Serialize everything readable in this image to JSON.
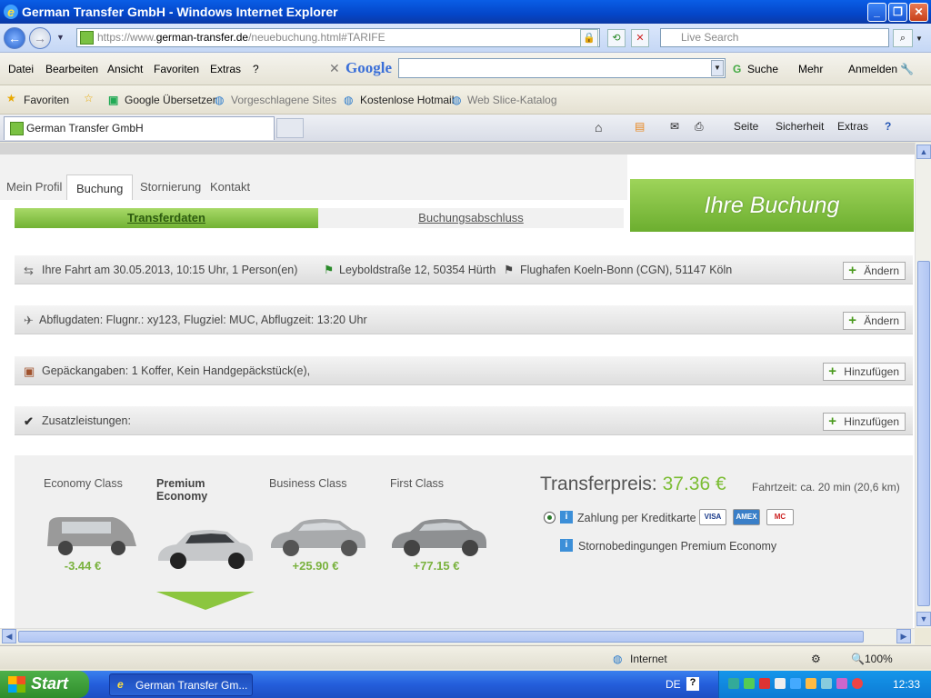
{
  "window": {
    "title": "German Transfer GmbH - Windows Internet Explorer",
    "min": "_",
    "max": "❐",
    "close": "✕"
  },
  "address": {
    "prefix": "https://www.",
    "host": "german-transfer.de",
    "path": "/neuebuchung.html#TARIFE",
    "live_search": "Live Search"
  },
  "menu": [
    "Datei",
    "Bearbeiten",
    "Ansicht",
    "Favoriten",
    "Extras",
    "?"
  ],
  "google": {
    "logo": "Google",
    "suche": "Suche",
    "mehr": "Mehr",
    "anmelden": "Anmelden"
  },
  "favorites": {
    "label": "Favoriten",
    "items": [
      "Google Übersetzer",
      "Vorgeschlagene Sites",
      "Kostenlose Hotmail",
      "Web Slice-Katalog"
    ]
  },
  "tab": {
    "label": "German Transfer GmbH",
    "seite": "Seite",
    "sicherheit": "Sicherheit",
    "extras": "Extras"
  },
  "page": {
    "tabs": [
      "Mein Profil",
      "Buchung",
      "Stornierung",
      "Kontakt"
    ],
    "banner": "Ihre Buchung",
    "step1": "Transferdaten",
    "step2": "Buchungsabschluss",
    "rows": [
      {
        "pre": "Ihre Fahrt am 30.05.2013,   10:15 Uhr,   1 Person(en)",
        "from": "Leyboldstraße 12, 50354 Hürth",
        "to": "Flughafen Koeln-Bonn (CGN), 51147 Köln",
        "btn": "Ändern"
      },
      {
        "text": "Abflugdaten:   Flugnr.: xy123,   Flugziel: MUC,   Abflugzeit: 13:20 Uhr",
        "btn": "Ändern"
      },
      {
        "text": "Gepäckangaben:   1 Koffer,   Kein Handgepäckstück(e),",
        "btn": "Hinzufügen"
      },
      {
        "text": "Zusatzleistungen:",
        "btn": "Hinzufügen"
      }
    ],
    "classes": [
      {
        "name": "Economy Class",
        "price": "-3.44 €"
      },
      {
        "name": "Premium Economy",
        "price": ""
      },
      {
        "name": "Business Class",
        "price": "+25.90 €"
      },
      {
        "name": "First Class",
        "price": "+77.15 €"
      }
    ],
    "transferpreis_label": "Transferpreis:",
    "transferpreis_value": "37.36 €",
    "fahrzeit": "Fahrtzeit: ca.  20 min (20,6 km)",
    "payment": "Zahlung per Kreditkarte",
    "cards": [
      "VISA",
      "AMEX",
      "MC"
    ],
    "storno": "Stornobedingungen Premium Economy"
  },
  "status": {
    "zone": "Internet",
    "zoom": "100%"
  },
  "taskbar": {
    "start": "Start",
    "task": "German Transfer Gm...",
    "lang": "DE",
    "clock": "12:33"
  }
}
